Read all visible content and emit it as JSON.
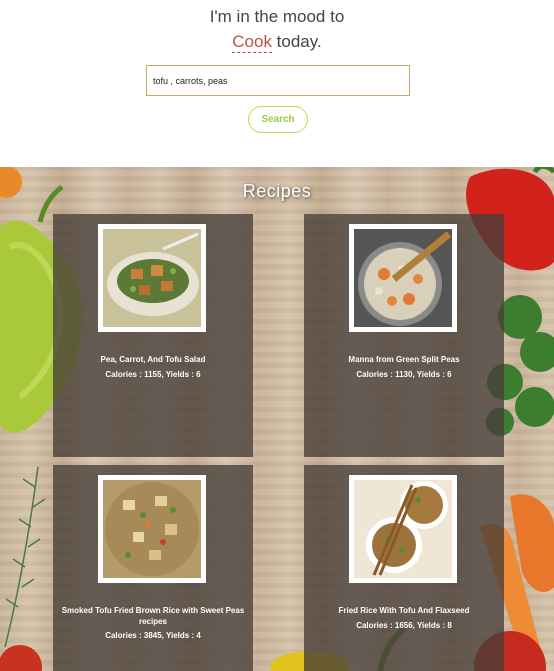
{
  "header": {
    "mood_prefix": "I'm in the mood to",
    "mood_word": "Cook",
    "mood_suffix": " today."
  },
  "search": {
    "value": "tofu , carrots, peas",
    "button_label": "Search"
  },
  "recipes": {
    "section_title": "Recipes",
    "info_template": "Calories : {calories}, Yields : {yields}",
    "items": [
      {
        "title": "Pea, Carrot, And Tofu Salad",
        "info": "Calories : 1155, Yields : 6"
      },
      {
        "title": "Manna from Green Split Peas",
        "info": "Calories : 1130, Yields : 6"
      },
      {
        "title": "Smoked Tofu Fried Brown Rice with Sweet Peas recipes",
        "info": "Calories : 3845, Yields : 4"
      },
      {
        "title": "Fried Rice With Tofu And Flaxseed",
        "info": "Calories : 1656, Yields : 8"
      }
    ]
  },
  "colors": {
    "accent": "#c0504d",
    "button": "#9ccc3a",
    "card_overlay": "#463e38"
  }
}
